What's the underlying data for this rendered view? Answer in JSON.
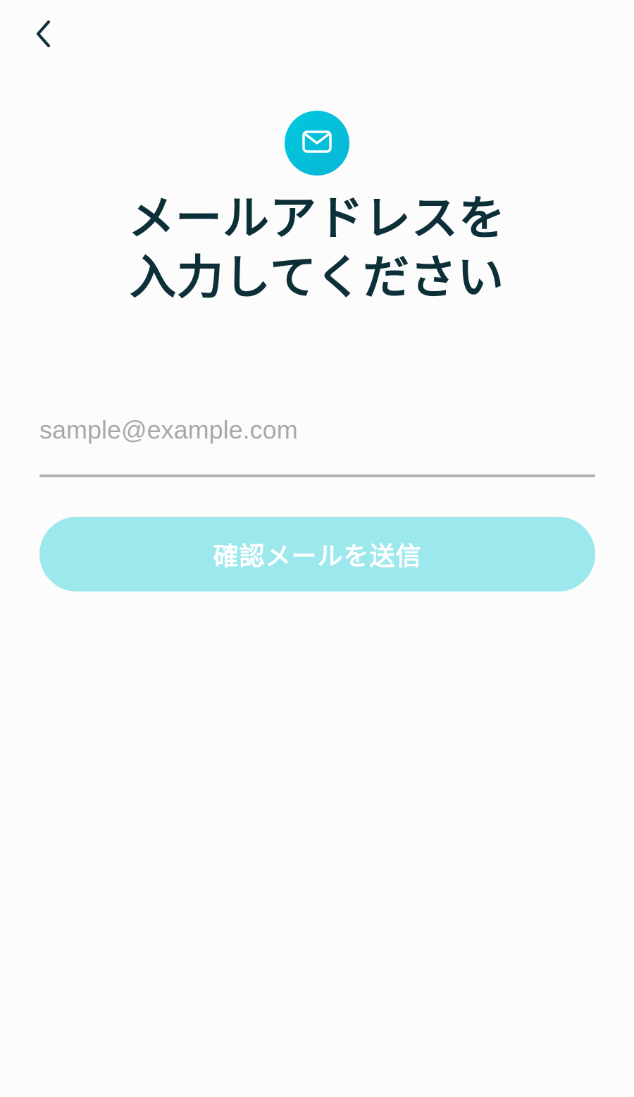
{
  "nav": {
    "back_icon": "chevron-left-icon"
  },
  "header": {
    "badge_icon": "mail-icon",
    "badge_color": "#00c3dc",
    "title_line1": "メールアドレスを",
    "title_line2": "入力してください"
  },
  "form": {
    "email_placeholder": "sample@example.com",
    "email_value": "",
    "submit_label": "確認メールを送信",
    "submit_enabled": false,
    "submit_color": "#9de8ed"
  },
  "colors": {
    "title_text": "#0c2f38",
    "background": "#fcfcfd"
  }
}
